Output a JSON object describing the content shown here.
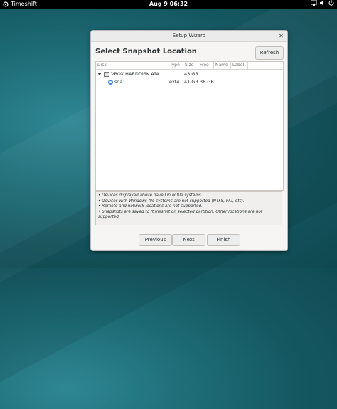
{
  "topbar": {
    "app_name": "Timeshift",
    "clock": "Aug 9  06:32"
  },
  "dialog": {
    "title": "Setup Wizard",
    "heading": "Select Snapshot Location",
    "refresh_label": "Refresh",
    "columns": [
      "Disk",
      "Type",
      "Size",
      "Free",
      "Name",
      "Label"
    ],
    "disk": {
      "name": "VBOX HARDDISK ATA",
      "size": "43 GB"
    },
    "partition": {
      "name": "sda1",
      "type": "ext4",
      "size": "41 GB",
      "free": "36 GB"
    },
    "notes": [
      "• Devices displayed above have Linux file systems.",
      "• Devices with Windows file systems are not supported (NTFS, FAT, etc).",
      "• Remote and network locations are not supported.",
      "• Snapshots are saved to /timeshift on selected partition. Other locations are not",
      "supported."
    ],
    "buttons": {
      "previous": "Previous",
      "next": "Next",
      "finish": "Finish"
    }
  }
}
